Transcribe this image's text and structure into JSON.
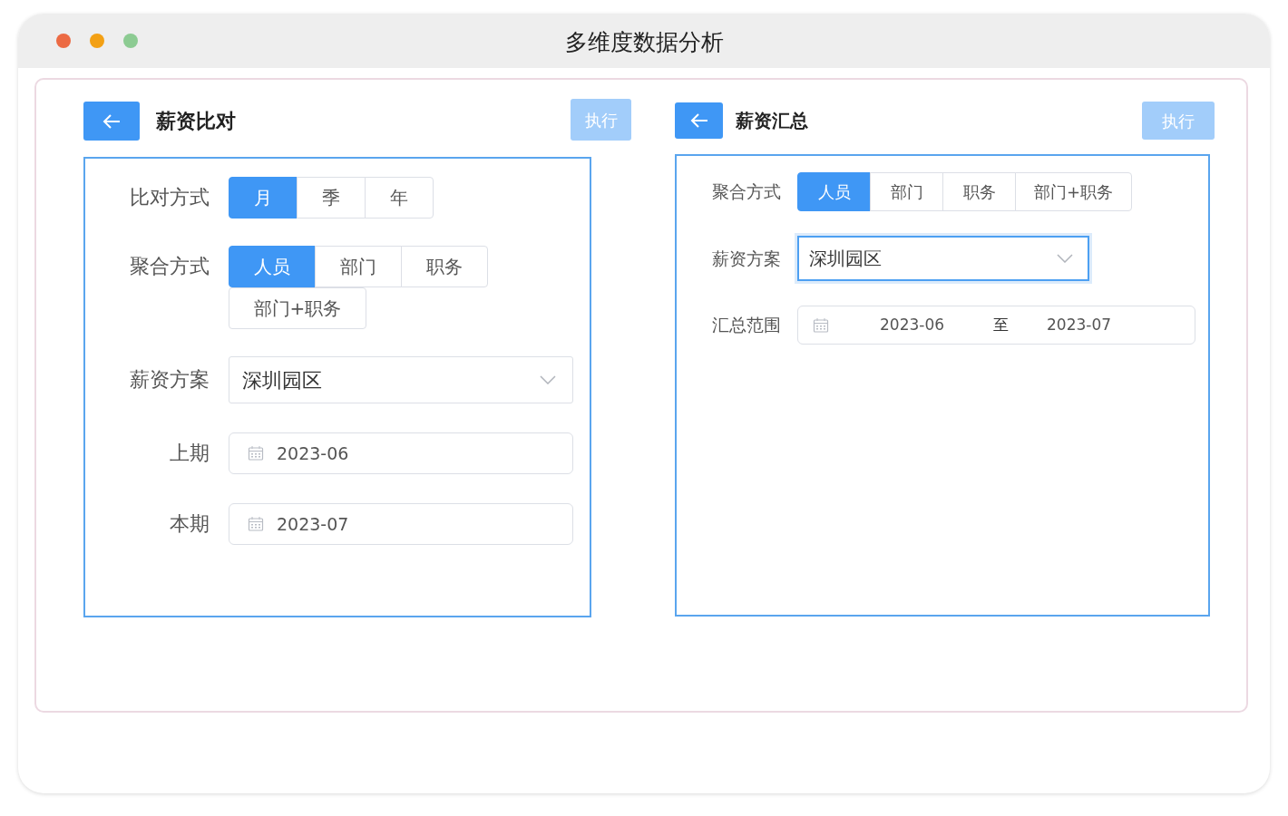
{
  "window": {
    "title": "多维度数据分析"
  },
  "panels": [
    {
      "title": "薪资比对",
      "execute": {
        "label": "执行",
        "disabled": true
      },
      "fields": [
        {
          "kind": "segmented",
          "label": "比对方式",
          "options": [
            {
              "label": "月",
              "selected": true
            },
            {
              "label": "季",
              "selected": false
            },
            {
              "label": "年",
              "selected": false
            }
          ]
        },
        {
          "kind": "segmented",
          "label": "聚合方式",
          "options": [
            {
              "label": "人员",
              "selected": true
            },
            {
              "label": "部门",
              "selected": false
            },
            {
              "label": "职务",
              "selected": false
            },
            {
              "label": "部门+职务",
              "selected": false
            }
          ]
        },
        {
          "kind": "select",
          "label": "薪资方案",
          "value": "深圳园区",
          "focused": false
        },
        {
          "kind": "date",
          "label": "上期",
          "value": "2023-06"
        },
        {
          "kind": "date",
          "label": "本期",
          "value": "2023-07"
        }
      ]
    },
    {
      "title": "薪资汇总",
      "execute": {
        "label": "执行",
        "disabled": true
      },
      "fields": [
        {
          "kind": "segmented",
          "label": "聚合方式",
          "options": [
            {
              "label": "人员",
              "selected": true
            },
            {
              "label": "部门",
              "selected": false
            },
            {
              "label": "职务",
              "selected": false
            },
            {
              "label": "部门+职务",
              "selected": false
            }
          ]
        },
        {
          "kind": "select",
          "label": "薪资方案",
          "value": "深圳园区",
          "focused": true
        },
        {
          "kind": "range",
          "label": "汇总范围",
          "start": "2023-06",
          "separator": "至",
          "end": "2023-07"
        }
      ]
    }
  ]
}
